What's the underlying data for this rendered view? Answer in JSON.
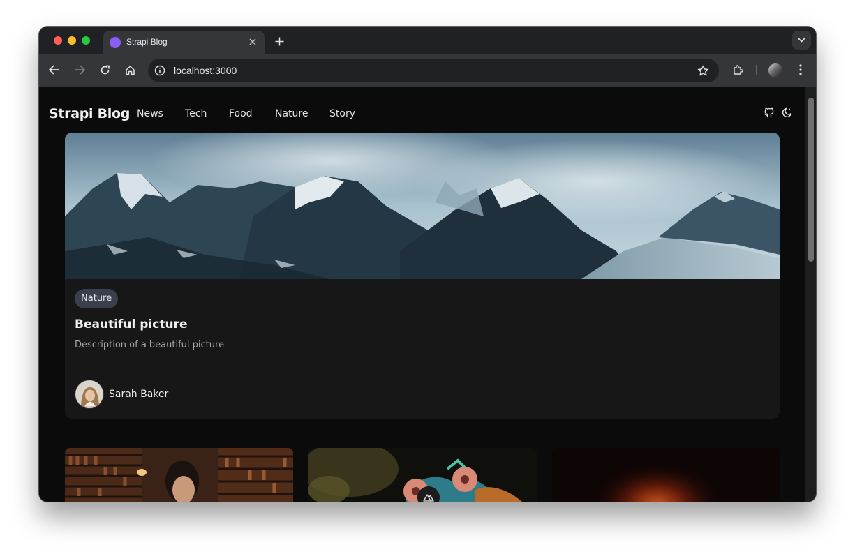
{
  "browser": {
    "tab_title": "Strapi Blog",
    "url": "localhost:3000",
    "icons": [
      "close-icon",
      "plus-icon",
      "chevron-down-icon",
      "back-arrow-icon",
      "forward-arrow-icon",
      "reload-icon",
      "home-icon",
      "info-icon",
      "star-icon",
      "extensions-icon",
      "kebab-menu-icon"
    ]
  },
  "site": {
    "brand": "Strapi Blog",
    "nav": [
      "News",
      "Tech",
      "Food",
      "Nature",
      "Story"
    ],
    "nav_icons": [
      "github-icon",
      "moon-icon"
    ]
  },
  "featured_post": {
    "category": "Nature",
    "title": "Beautiful picture",
    "description": "Description of a beautiful picture",
    "author": "Sarah Baker",
    "image": "snowy-mountain-glacier-image"
  },
  "more_posts": [
    {
      "image": "library-portrait-image"
    },
    {
      "image": "mantis-shrimp-image"
    },
    {
      "image": "dark-red-glow-image"
    }
  ],
  "colors": {
    "page_bg": "#0b0b0b",
    "card_bg": "#171717",
    "tag_bg": "#3b3f4d",
    "favicon": "#8b5cf6"
  }
}
